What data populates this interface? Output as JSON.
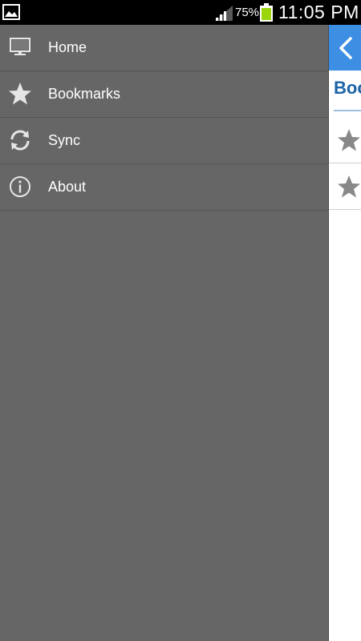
{
  "status_bar": {
    "battery_percent": "75%",
    "time": "11:05 PM",
    "icons": [
      "gallery-icon",
      "signal-icon",
      "battery-icon"
    ],
    "battery_color": "#9ad60b"
  },
  "drawer": {
    "background": "#666666",
    "items": [
      {
        "label": "Home",
        "icon": "monitor-icon"
      },
      {
        "label": "Bookmarks",
        "icon": "star-icon"
      },
      {
        "label": "Sync",
        "icon": "sync-icon"
      },
      {
        "label": "About",
        "icon": "info-icon"
      }
    ]
  },
  "content": {
    "header_color": "#3d8fe3",
    "back_icon": "chevron-left-icon",
    "title": "Boo",
    "rows": [
      {
        "icon": "star-icon"
      },
      {
        "icon": "star-icon"
      }
    ]
  }
}
